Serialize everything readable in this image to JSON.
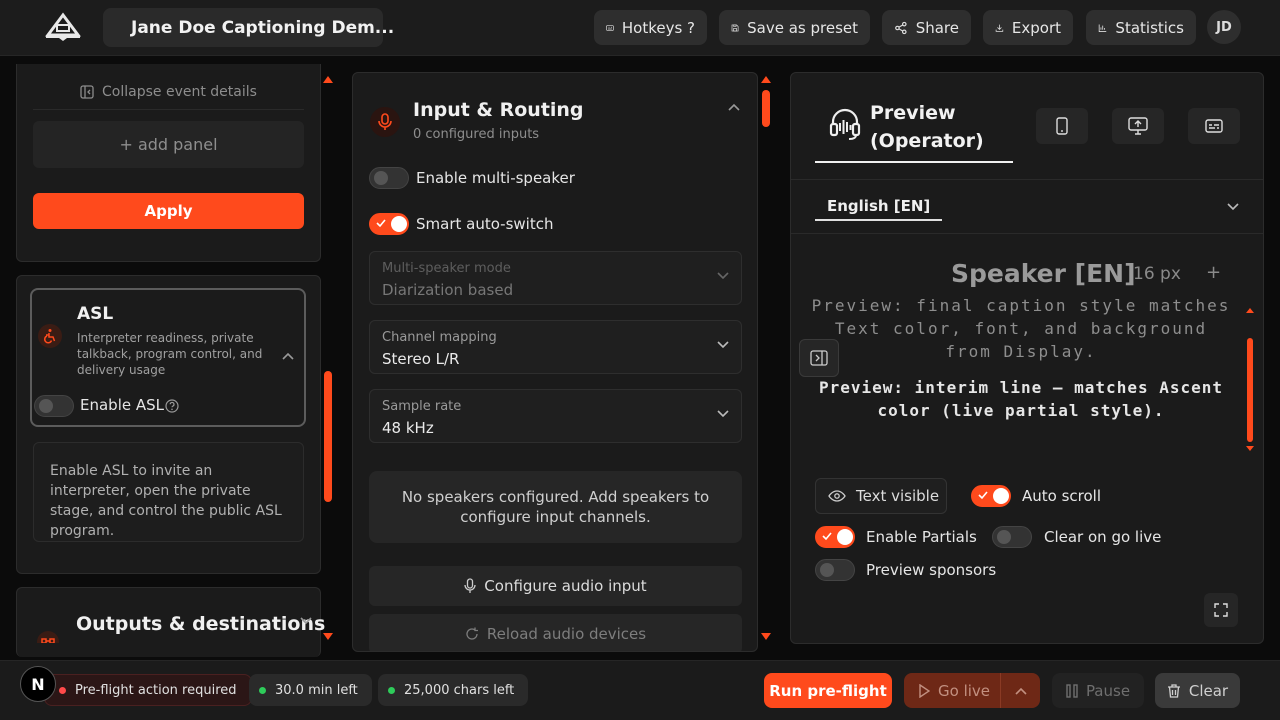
{
  "header": {
    "session_title": "Jane Doe Captioning Dem...",
    "hotkeys_label": "Hotkeys ?",
    "save_preset_label": "Save as preset",
    "share_label": "Share",
    "export_label": "Export",
    "statistics_label": "Statistics",
    "avatar_initials": "JD"
  },
  "left": {
    "collapse_label": "Collapse event details",
    "add_panel_label": "+ add panel",
    "apply_label": "Apply",
    "asl": {
      "title": "ASL",
      "description": "Interpreter readiness, private talkback, program control, and delivery usage",
      "enable_label": "Enable ASL",
      "enabled": false,
      "info_text": "Enable ASL to invite an interpreter, open the private stage, and control the public ASL program."
    },
    "outputs_title": "Outputs & destinations"
  },
  "input_routing": {
    "title": "Input & Routing",
    "subtitle": "0 configured inputs",
    "multi_speaker_label": "Enable multi-speaker",
    "multi_speaker_enabled": false,
    "auto_switch_label": "Smart auto-switch",
    "auto_switch_enabled": true,
    "fields": [
      {
        "label": "Multi-speaker mode",
        "value": "Diarization based",
        "disabled": true
      },
      {
        "label": "Channel mapping",
        "value": "Stereo L/R",
        "disabled": false
      },
      {
        "label": "Sample rate",
        "value": "48 kHz",
        "disabled": false
      }
    ],
    "no_speakers_text": "No speakers configured. Add speakers to configure input channels.",
    "configure_audio_label": "Configure audio input",
    "reload_devices_label": "Reload audio devices"
  },
  "preview": {
    "title": "Preview (Operator)",
    "language_tab": "English [EN]",
    "speaker_label": "Speaker [EN]",
    "font_size": "16 px",
    "plus_label": "+",
    "final_caption": "Preview: final caption style matches Text color, font, and background from Display.",
    "interim_caption": "Preview: interim line — matches Ascent color (live partial style).",
    "text_visible_label": "Text visible",
    "auto_scroll_label": "Auto scroll",
    "auto_scroll_enabled": true,
    "enable_partials_label": "Enable Partials",
    "enable_partials_enabled": true,
    "clear_on_go_live_label": "Clear on go live",
    "clear_on_go_live_enabled": false,
    "preview_sponsors_label": "Preview sponsors",
    "preview_sponsors_enabled": false
  },
  "footer": {
    "avatar_letter": "N",
    "preflight_status": "Pre-flight action required",
    "time_left": "30.0 min left",
    "chars_left": "25,000 chars left",
    "run_preflight_label": "Run pre-flight",
    "go_live_label": "Go live",
    "pause_label": "Pause",
    "clear_label": "Clear"
  },
  "colors": {
    "accent": "#ff4a1c",
    "status_ok": "#2ecc5a",
    "status_warn": "#ff4a4a"
  }
}
